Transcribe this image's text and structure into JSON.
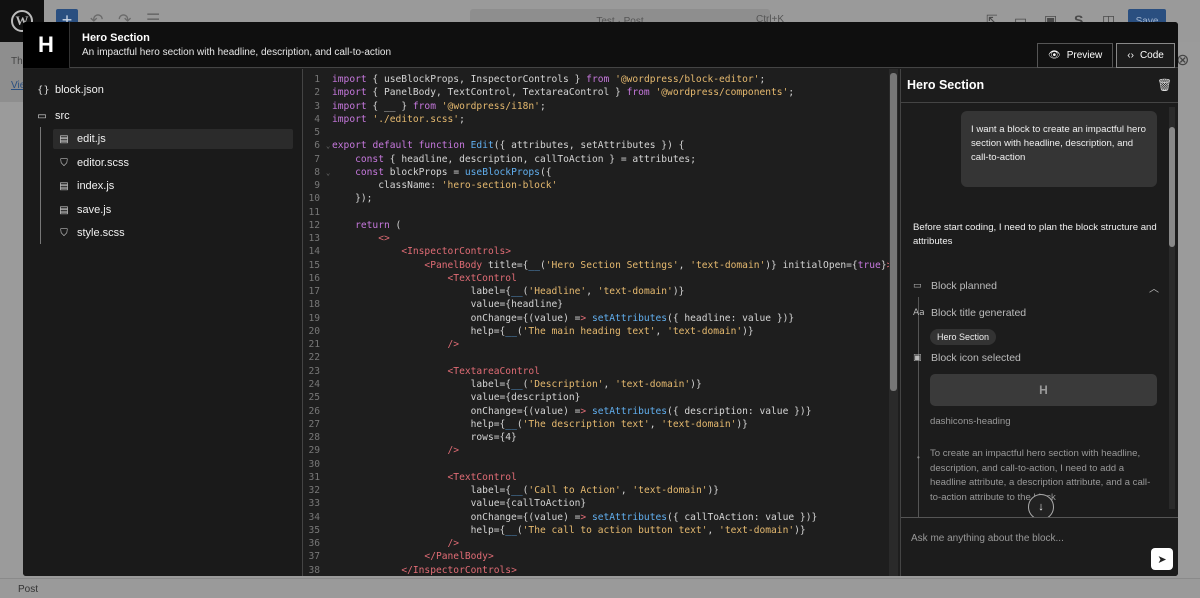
{
  "wp": {
    "logo_glyph": "W",
    "doc_title": "Test · Post",
    "shortcut": "Ctrl+K",
    "save_label": "Save",
    "notice_text": "Th",
    "notice_link": "Vie",
    "footer": "Post"
  },
  "modal": {
    "logo_letter": "H",
    "title": "Hero Section",
    "description": "An impactful hero section with headline, description, and call-to-action",
    "tabs": [
      {
        "label": "Preview",
        "icon": "eye-icon"
      },
      {
        "label": "Code",
        "icon": "code-icon"
      }
    ]
  },
  "tree": {
    "items": [
      {
        "label": "block.json",
        "icon": "{ }"
      },
      {
        "label": "src",
        "icon": "folder"
      },
      {
        "label": "edit.js",
        "icon": "file"
      },
      {
        "label": "editor.scss",
        "icon": "style"
      },
      {
        "label": "index.js",
        "icon": "file"
      },
      {
        "label": "save.js",
        "icon": "file"
      },
      {
        "label": "style.scss",
        "icon": "style"
      }
    ]
  },
  "code": {
    "lines": [
      "import { useBlockProps, InspectorControls } from '@wordpress/block-editor';",
      "import { PanelBody, TextControl, TextareaControl } from '@wordpress/components';",
      "import { __ } from '@wordpress/i18n';",
      "import './editor.scss';",
      "",
      "export default function Edit({ attributes, setAttributes }) {",
      "    const { headline, description, callToAction } = attributes;",
      "    const blockProps = useBlockProps({",
      "        className: 'hero-section-block'",
      "    });",
      "",
      "    return (",
      "        <>",
      "            <InspectorControls>",
      "                <PanelBody title={__('Hero Section Settings', 'text-domain')} initialOpen={true}>",
      "                    <TextControl",
      "                        label={__('Headline', 'text-domain')}",
      "                        value={headline}",
      "                        onChange={(value) => setAttributes({ headline: value })}",
      "                        help={__('The main heading text', 'text-domain')}",
      "                    />",
      "",
      "                    <TextareaControl",
      "                        label={__('Description', 'text-domain')}",
      "                        value={description}",
      "                        onChange={(value) => setAttributes({ description: value })}",
      "                        help={__('The description text', 'text-domain')}",
      "                        rows={4}",
      "                    />",
      "",
      "                    <TextControl",
      "                        label={__('Call to Action', 'text-domain')}",
      "                        value={callToAction}",
      "                        onChange={(value) => setAttributes({ callToAction: value })}",
      "                        help={__('The call to action button text', 'text-domain')}",
      "                    />",
      "                </PanelBody>",
      "            </InspectorControls>"
    ],
    "fold_lines": [
      6,
      8
    ]
  },
  "chat": {
    "title": "Hero Section",
    "user_message": "I want a block to create an impactful hero section with headline, description, and call-to-action",
    "assistant_message": "Before start coding, I need to plan the block structure and attributes",
    "step_planned": "Block planned",
    "step_title": "Block title generated",
    "title_badge": "Hero Section",
    "step_icon": "Block icon selected",
    "icon_preview": "H",
    "icon_name": "dashicons-heading",
    "thinking": "To create an impactful hero section with headline, description, and call-to-action, I need to add a headline attribute, a description attribute, and a call-to-action attribute to the block",
    "input_placeholder": "Ask me anything about the block..."
  }
}
